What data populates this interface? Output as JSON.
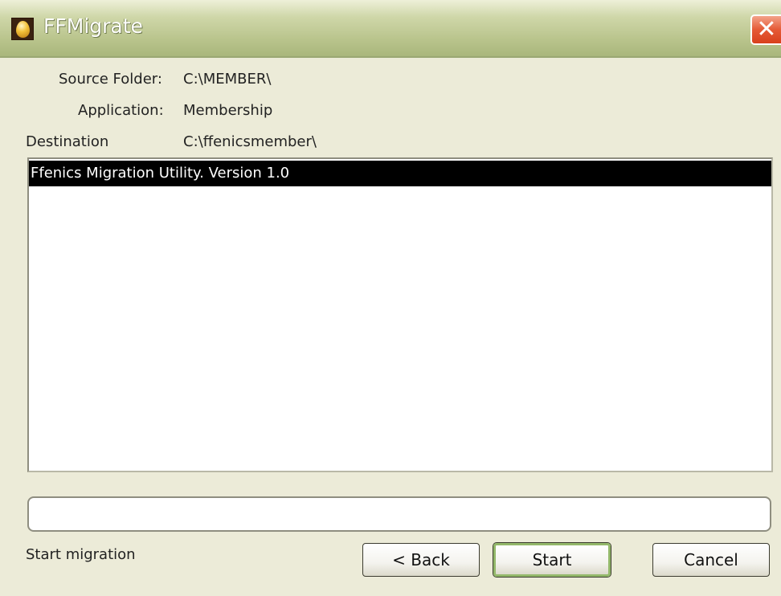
{
  "window": {
    "title": "FFMigrate",
    "close_glyph": "✕",
    "app_icon": "egg-icon"
  },
  "info": {
    "source_label": "Source Folder:",
    "source_value": "C:\\MEMBER\\",
    "application_label": "Application:",
    "application_value": "Membership",
    "destination_label": "Destination",
    "destination_value": "C:\\ffenicsmember\\"
  },
  "log": {
    "lines": [
      "Ffenics Migration Utility. Version 1.0"
    ]
  },
  "progress": {
    "value": 0
  },
  "status": {
    "text": "Start migration"
  },
  "buttons": {
    "back_label": "< Back",
    "start_label": "Start",
    "cancel_label": "Cancel"
  },
  "colors": {
    "titlebar": "#b9c48c",
    "dialog_background": "#ecebd8",
    "close_button": "#e55a36",
    "selection": "#000000",
    "default_button_border": "#93b86a"
  }
}
